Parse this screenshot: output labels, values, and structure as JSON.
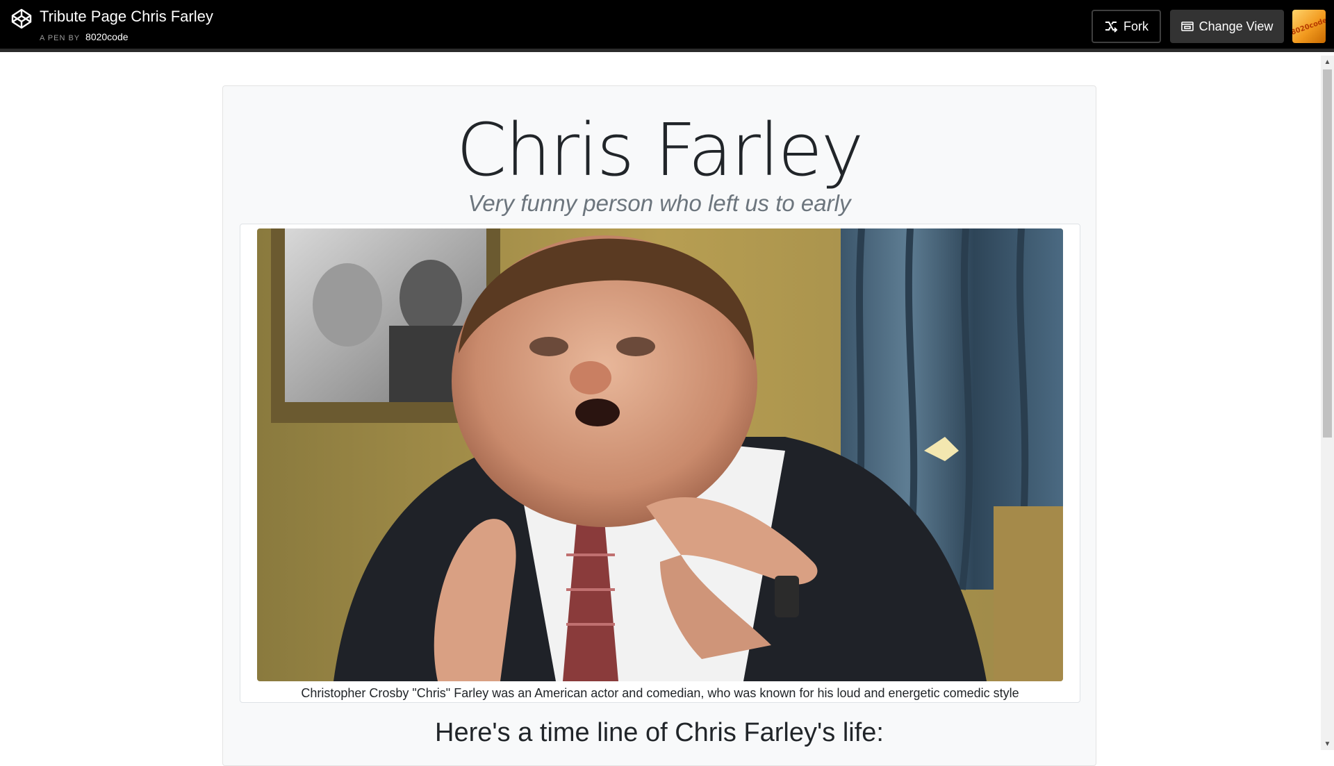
{
  "header": {
    "pen_title": "Tribute Page Chris Farley",
    "pen_by_label": "A PEN BY",
    "author": "8020code",
    "fork_label": "Fork",
    "change_view_label": "Change View",
    "avatar_text": "8020code"
  },
  "page": {
    "title": "Chris Farley",
    "subtitle": "Very funny person who left us to early",
    "caption": "Christopher Crosby \"Chris\" Farley was an American actor and comedian, who was known for his loud and energetic comedic style",
    "timeline_heading": "Here's a time line of Chris Farley's life:"
  },
  "colors": {
    "topbar": "#000000",
    "content_bg": "#f8f9fa",
    "subtitle": "#6c757d"
  },
  "icons": {
    "logo": "codepen-logo-icon",
    "fork": "fork-icon",
    "change_view": "change-view-icon"
  }
}
